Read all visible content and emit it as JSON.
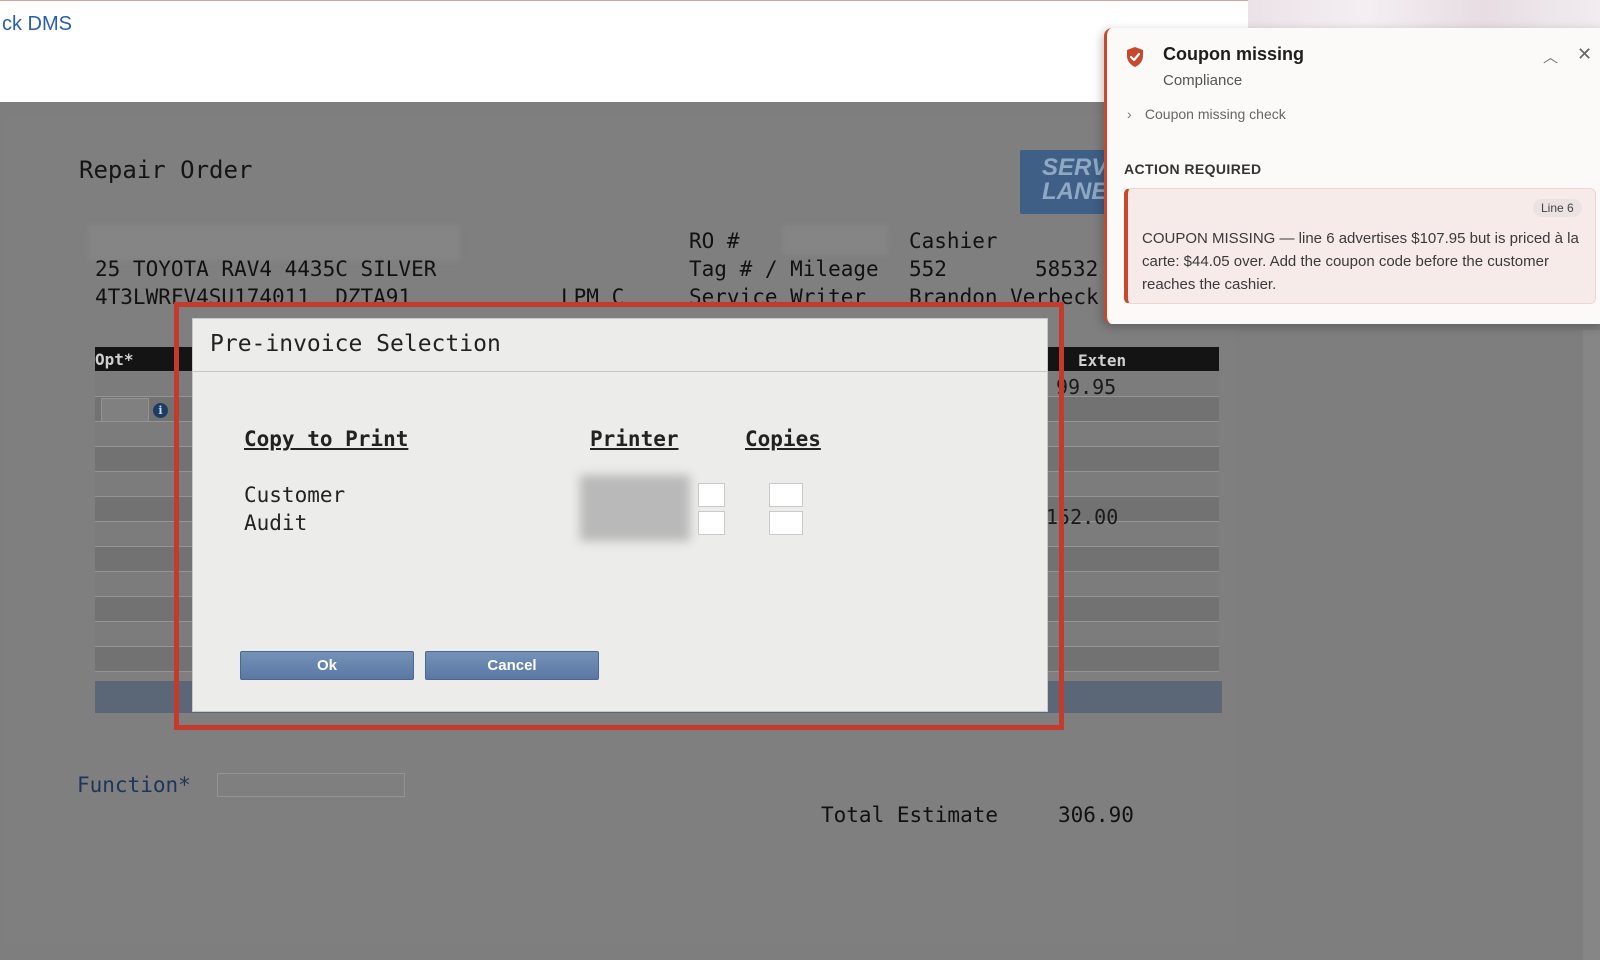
{
  "app": {
    "title": "ck DMS"
  },
  "repair_order": {
    "title": "Repair Order",
    "logo_text": "SERV LANE",
    "vehicle_line": "25 TOYOTA RAV4 4435C SILVER",
    "vin_line": "4T3LWRFV4SU174011  DZTA91",
    "lpm_label": "LPM C",
    "ro_label": "RO #",
    "tag_label": "Tag # / Mileage",
    "service_writer_label": "Service Writer",
    "cashier_label": "Cashier",
    "tag_value": "552",
    "mileage_value": "58532",
    "service_writer_value": "Brandon Verbeck"
  },
  "table": {
    "col_opt": "Opt*",
    "col_exten": "Exten",
    "row1_exten": "99.95",
    "row6_exten": "152.00"
  },
  "function": {
    "label": "Function*"
  },
  "totals": {
    "label": "Total Estimate",
    "value": "306.90"
  },
  "dialog": {
    "title": "Pre-invoice Selection",
    "col_copy": "Copy to Print",
    "col_printer": "Printer",
    "col_copies": "Copies",
    "rows": [
      "Customer",
      "Audit"
    ],
    "ok_label": "Ok",
    "cancel_label": "Cancel"
  },
  "notification": {
    "title": "Coupon missing",
    "subtitle": "Compliance",
    "check_label": "Coupon missing check",
    "action_heading": "ACTION REQUIRED",
    "line_badge": "Line 6",
    "message": "COUPON MISSING — line 6 advertises $107.95 but is priced à la carte: $44.05 over. Add the coupon code before the customer reaches the cashier.",
    "accent_color": "#c8482e"
  }
}
